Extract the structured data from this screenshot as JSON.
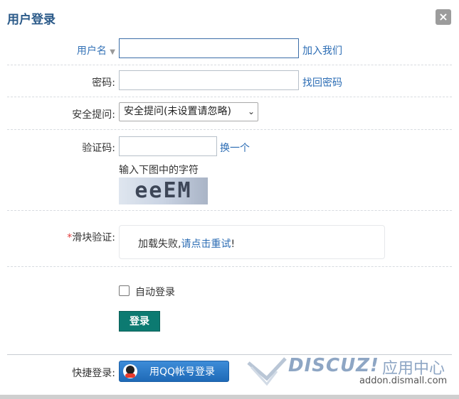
{
  "dialog": {
    "title": "用户登录",
    "close": "×"
  },
  "username": {
    "label": "用户名",
    "value": "",
    "link": "加入我们"
  },
  "password": {
    "label": "密码:",
    "value": "",
    "link": "找回密码"
  },
  "security": {
    "label": "安全提问:",
    "selected": "安全提问(未设置请忽略)"
  },
  "captcha": {
    "label": "验证码:",
    "value": "",
    "refresh": "换一个",
    "hint": "输入下图中的字符",
    "image_text": "eeEM"
  },
  "slider": {
    "asterisk": "*",
    "label": "滑块验证:",
    "fail_text": "加载失败,",
    "retry_link": "请点击重试",
    "suffix": "!"
  },
  "remember": {
    "label": "自动登录",
    "checked": false
  },
  "login_button": "登录",
  "quick_login": {
    "label": "快捷登录:",
    "qq_button": "用QQ帐号登录"
  },
  "watermark": {
    "brand": "DISCUZ!",
    "center": "应用中心",
    "url": "addon.dismall.com"
  },
  "colors": {
    "title": "#2b5a89",
    "link": "#2b6cb4",
    "login_button": "#0c7a71",
    "qq_button": "#1f6ab7"
  }
}
